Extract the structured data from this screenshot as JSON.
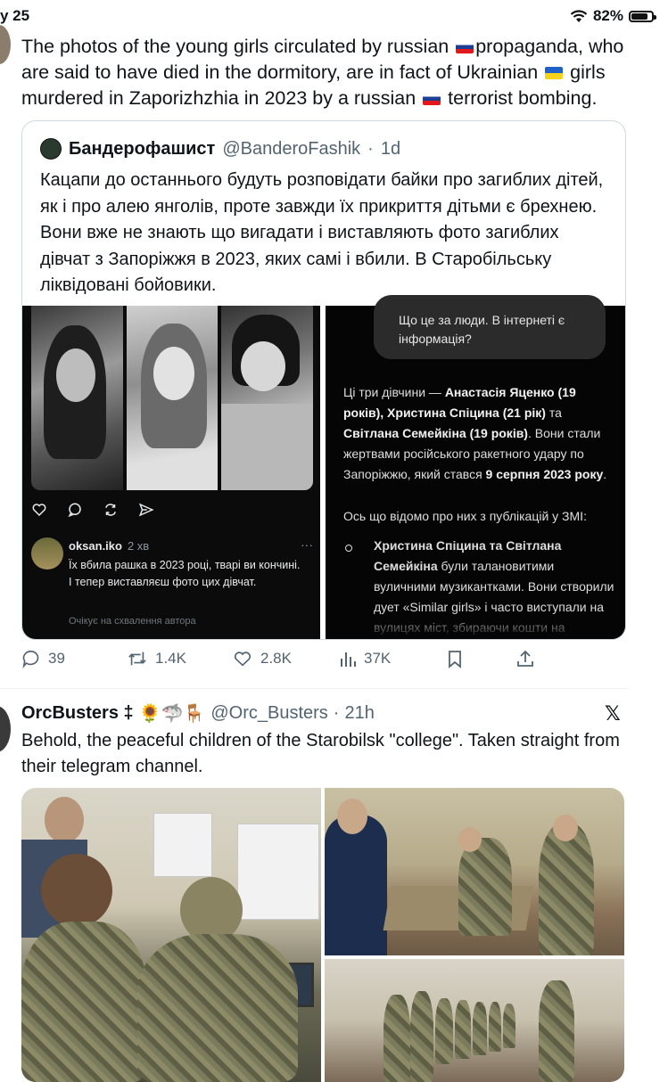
{
  "status_bar": {
    "time": "у 25",
    "battery": "82%",
    "battery_level": 0.82
  },
  "tweet1": {
    "text_parts": [
      "The photos of the young girls circulated by russian ",
      "propaganda, who are said to have died in the dormitory, are in fact of Ukrainian ",
      " girls murdered in Zaporizhzhia in 2023 by a russian ",
      " terrorist bombing."
    ],
    "quote": {
      "name": "Бандерофашист",
      "handle": "@BanderoFashik",
      "time": "1d",
      "text": "Кацапи до останнього будуть розповідати байки про загиблих дітей, як і про алею янголів, проте завжди їх прикриття дітьми є брехнею. Вони вже не знають що вигадати і виставляють фото загиблих дівчат з Запоріжжя в 2023, яких самі і вбили. В Старобільську ліквідовані бойовики.",
      "comment": {
        "user": "oksan.iko",
        "time": "2 хв",
        "more": "···",
        "body": "Їх вбила рашка в 2023 році, тварі ви кончині. І тепер виставляєш фото цих дівчат.",
        "note": "Очікує на схвалення автора"
      },
      "ai": {
        "question": "Що це за люди. В інтернеті є інформація?",
        "p1_a": "Ці три дівчини — ",
        "p1_b": "Анастасія Яценко (19 років), Христина Спіцина (21 рік)",
        "p1_c": " та ",
        "p1_d": "Світлана Семейкіна (19 років)",
        "p1_e": ". Вони стали жертвами російського ракетного удару по Запоріжжю, який стався ",
        "p1_f": "9 серпня 2023 року",
        "p1_g": ".",
        "p2": "Ось що відомо про них з публікацій у ЗМІ:",
        "p3_a": "Христина Спіцина та Світлана Семейкіна",
        "p3_b": " були талановитими вуличними музикантками. Вони створили дует «Similar girls» і часто виступали на вулицях міст, збираючи кошти на підтримку ЗСУ і в них був"
      }
    },
    "actions": {
      "replies": "39",
      "reposts": "1.4K",
      "likes": "2.8K",
      "views": "37K"
    }
  },
  "tweet2": {
    "name": "OrcBusters ‡",
    "emojis": "🌻🦈🪑",
    "handle": "@Orc_Busters",
    "time": "21h",
    "text": "Behold, the peaceful children of the Starobilsk \"college\". Taken straight from their telegram channel.",
    "x_logo": "𝕏"
  },
  "icons": [
    "wifi-icon",
    "battery-icon",
    "reply-icon",
    "repost-icon",
    "like-icon",
    "views-icon",
    "bookmark-icon",
    "share-icon",
    "x-logo-icon"
  ]
}
